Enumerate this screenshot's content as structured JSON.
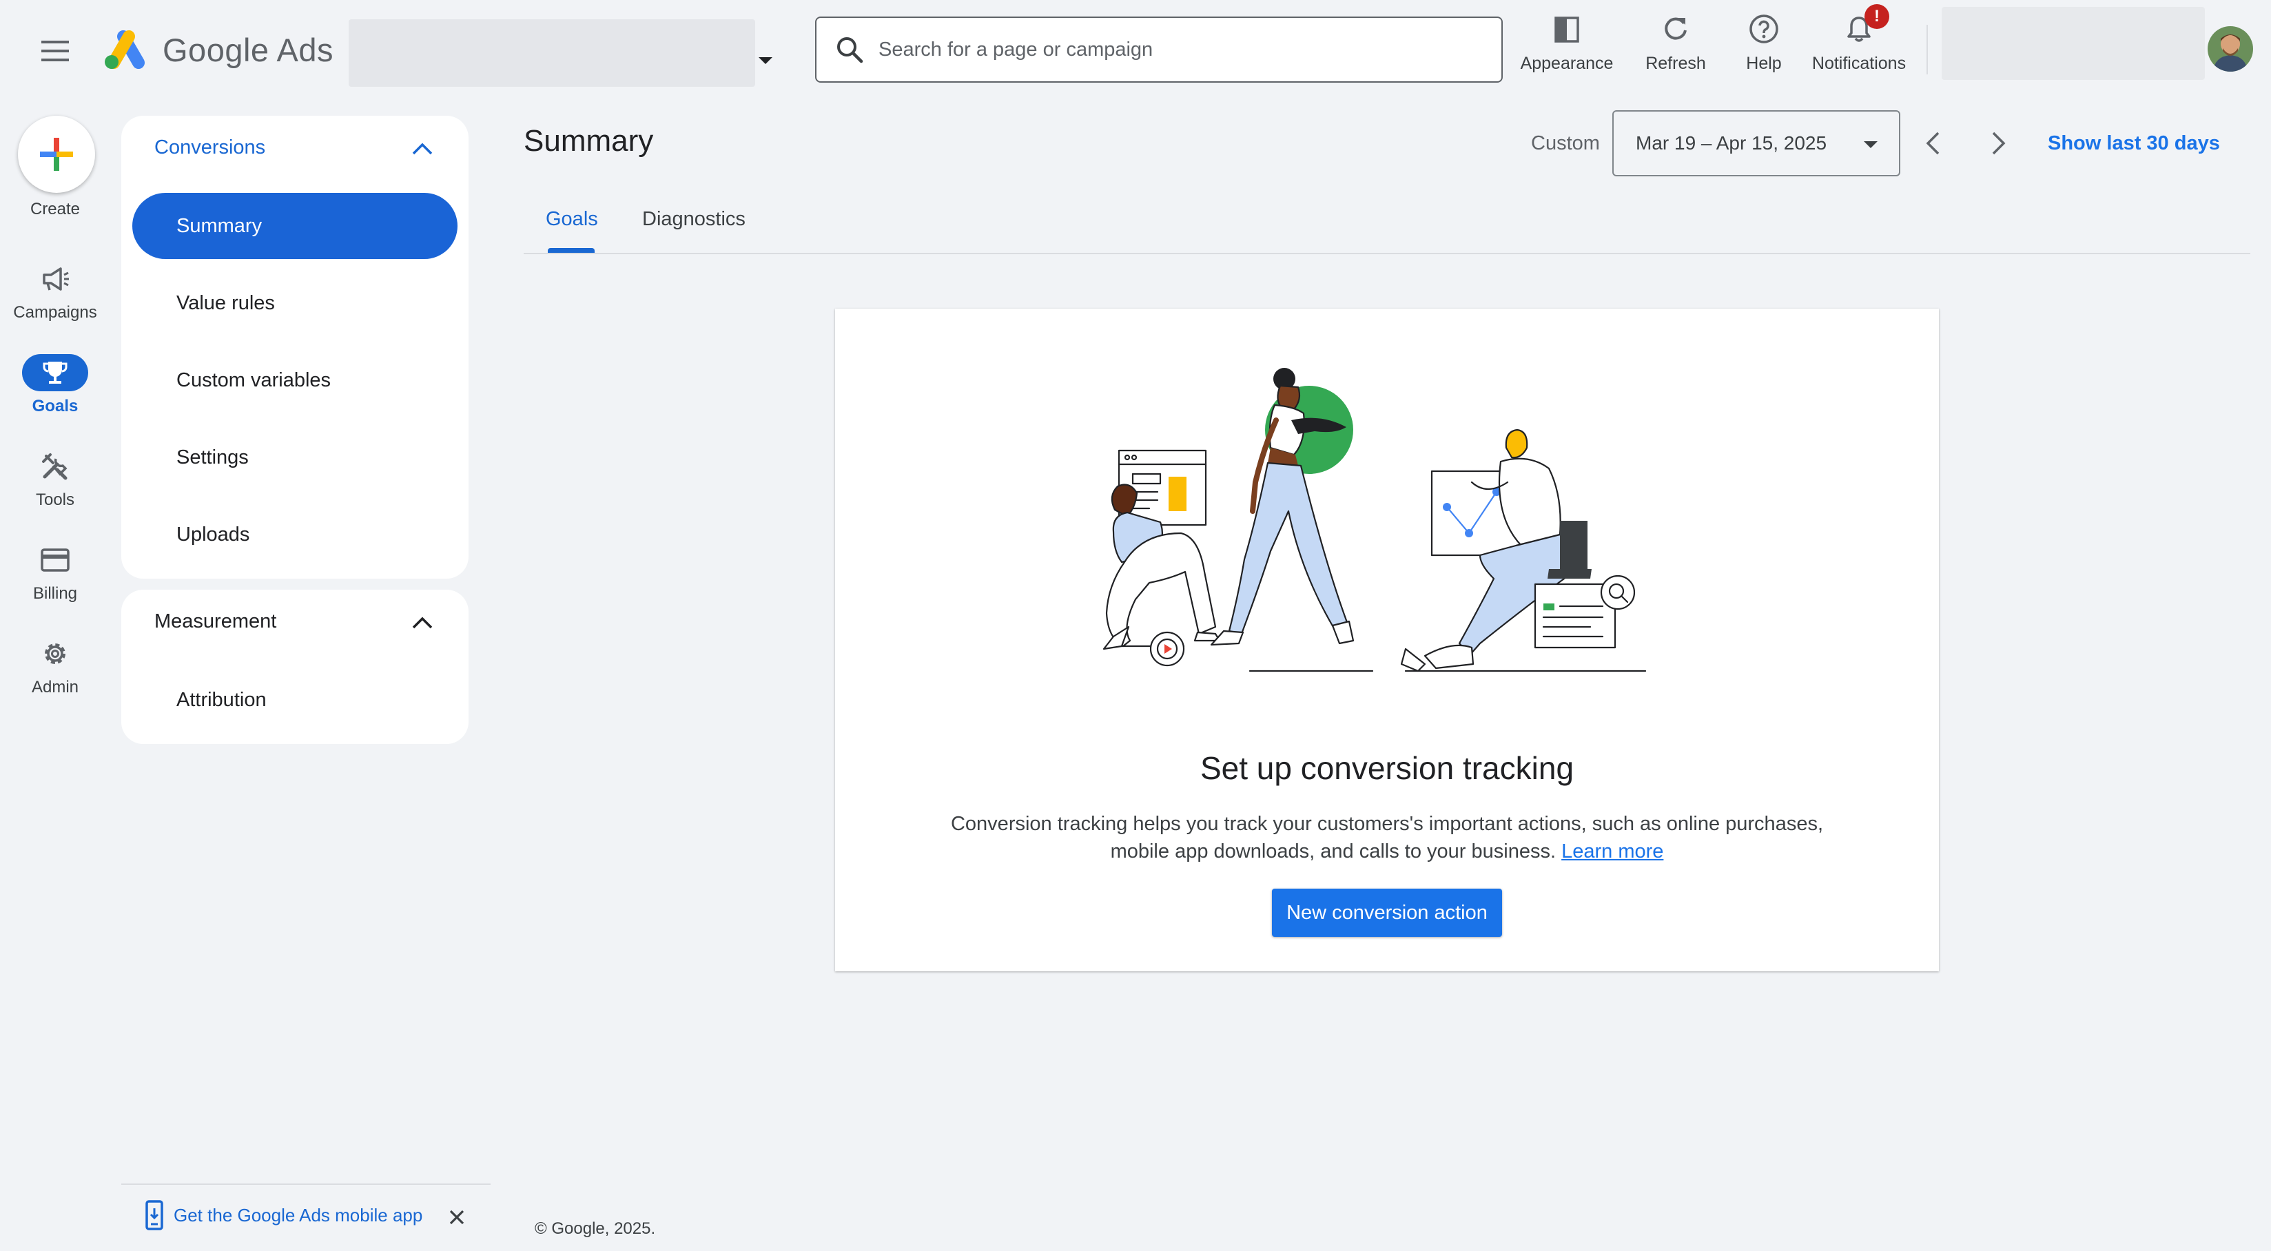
{
  "header": {
    "product_name": "Google Ads",
    "search_placeholder": "Search for a page or campaign",
    "actions": [
      {
        "label": "Appearance",
        "icon": "appearance-icon"
      },
      {
        "label": "Refresh",
        "icon": "refresh-icon"
      },
      {
        "label": "Help",
        "icon": "help-icon"
      },
      {
        "label": "Notifications",
        "icon": "bell-icon"
      }
    ],
    "notification_badge": "!"
  },
  "rail": {
    "create_label": "Create",
    "items": [
      {
        "label": "Campaigns",
        "icon": "megaphone-icon",
        "active": false
      },
      {
        "label": "Goals",
        "icon": "trophy-icon",
        "active": true
      },
      {
        "label": "Tools",
        "icon": "tools-icon",
        "active": false
      },
      {
        "label": "Billing",
        "icon": "credit-card-icon",
        "active": false
      },
      {
        "label": "Admin",
        "icon": "gear-icon",
        "active": false
      }
    ]
  },
  "nav": {
    "conversions": {
      "title": "Conversions",
      "items": [
        "Summary",
        "Value rules",
        "Custom variables",
        "Settings",
        "Uploads"
      ],
      "selected": "Summary"
    },
    "measurement": {
      "title": "Measurement",
      "items": [
        "Attribution"
      ]
    }
  },
  "main": {
    "title": "Summary",
    "date_range_type": "Custom",
    "date_range": "Mar 19 – Apr 15, 2025",
    "show_last_label": "Show last 30 days",
    "tabs": [
      {
        "label": "Goals",
        "active": true
      },
      {
        "label": "Diagnostics",
        "active": false
      }
    ]
  },
  "card": {
    "title": "Set up conversion tracking",
    "description": "Conversion tracking helps you track your customers's important actions, such as online purchases, mobile app downloads, and calls to your business.",
    "learn_more": "Learn more",
    "button_label": "New conversion action"
  },
  "footer": {
    "mobile_app_link": "Get the Google Ads mobile app",
    "copyright": "© Google, 2025."
  },
  "colors": {
    "accent": "#1a73e8",
    "nav_selected": "#1a64d6",
    "background": "#f1f3f6",
    "notification_badge": "#c5221f"
  }
}
